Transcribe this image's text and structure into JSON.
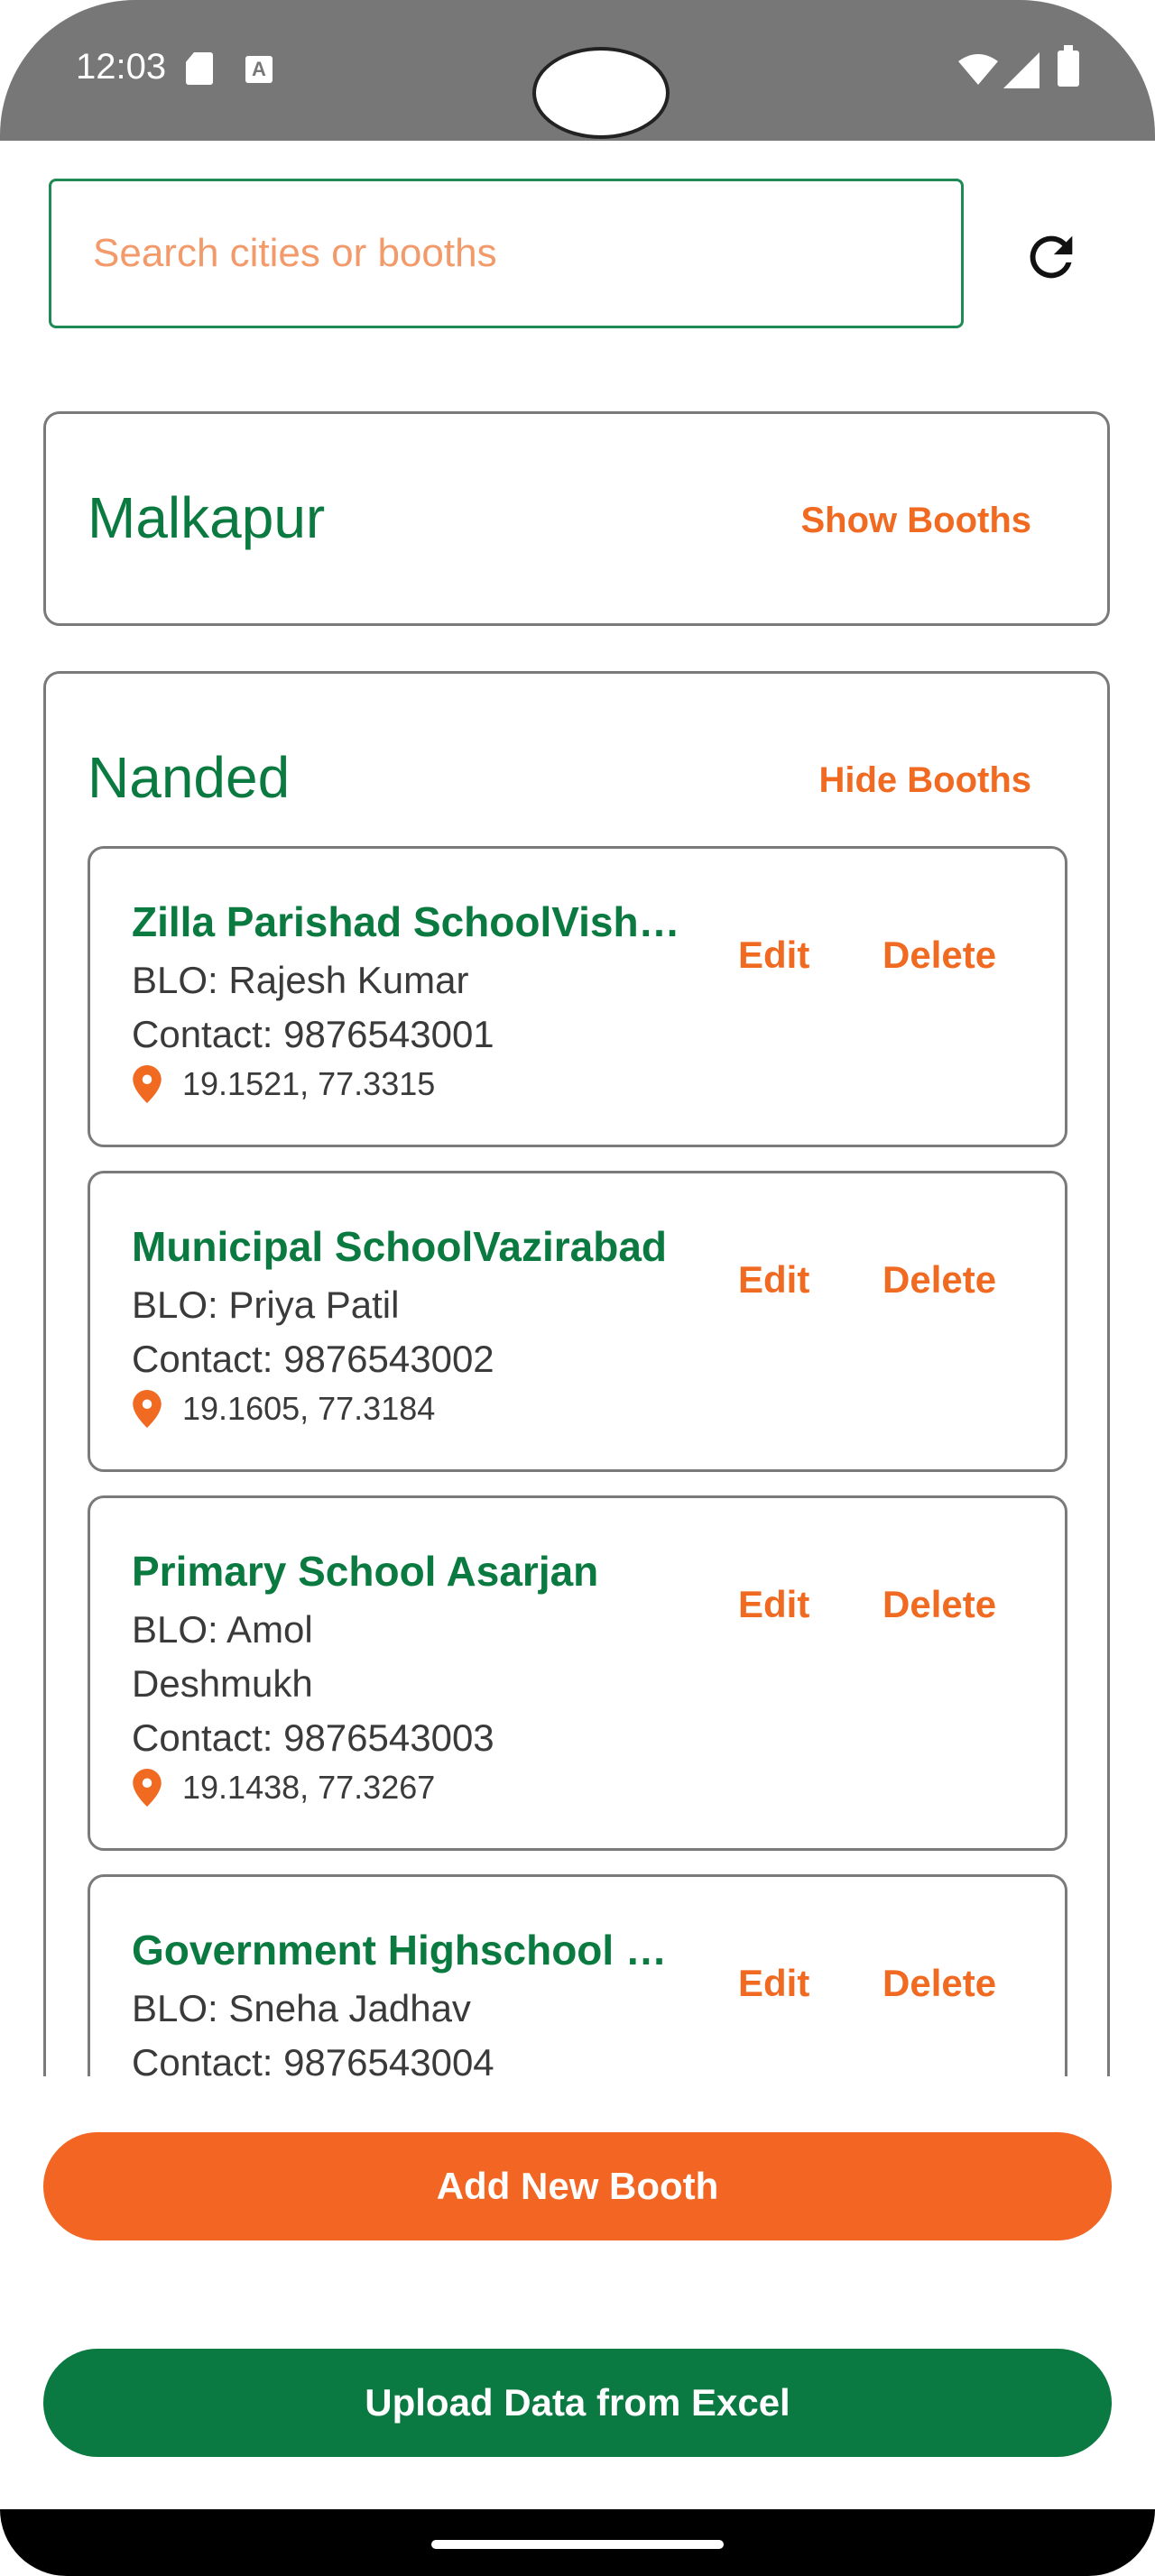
{
  "status": {
    "time": "12:03"
  },
  "search": {
    "placeholder": "Search cities or booths"
  },
  "cities": [
    {
      "name": "Malkapur",
      "toggle_label": "Show Booths"
    },
    {
      "name": "Nanded",
      "toggle_label": "Hide Booths"
    }
  ],
  "booths": [
    {
      "name": "Zilla Parishad SchoolVishnupuri",
      "blo": "BLO: Rajesh Kumar",
      "contact": "Contact: 9876543001",
      "coords": "19.1521, 77.3315",
      "edit": "Edit",
      "delete": "Delete"
    },
    {
      "name": "Municipal SchoolVazirabad",
      "blo": "BLO: Priya Patil",
      "contact": "Contact: 9876543002",
      "coords": "19.1605, 77.3184",
      "edit": "Edit",
      "delete": "Delete"
    },
    {
      "name": "Primary School Asarjan",
      "blo_line1": "BLO: Amol",
      "blo_line2": "Deshmukh",
      "contact": "Contact: 9876543003",
      "coords": "19.1438, 77.3267",
      "edit": "Edit",
      "delete": "Delete"
    },
    {
      "name": "Government Highschool Dhanegaon",
      "blo": "BLO: Sneha Jadhav",
      "contact": "Contact: 9876543004",
      "edit": "Edit",
      "delete": "Delete"
    }
  ],
  "actions": {
    "add_booth": "Add New Booth",
    "upload_excel": "Upload Data from Excel"
  },
  "colors": {
    "primary_green": "#0b7a40",
    "accent_orange": "#f06a22",
    "upload_green": "#0a7a42"
  }
}
